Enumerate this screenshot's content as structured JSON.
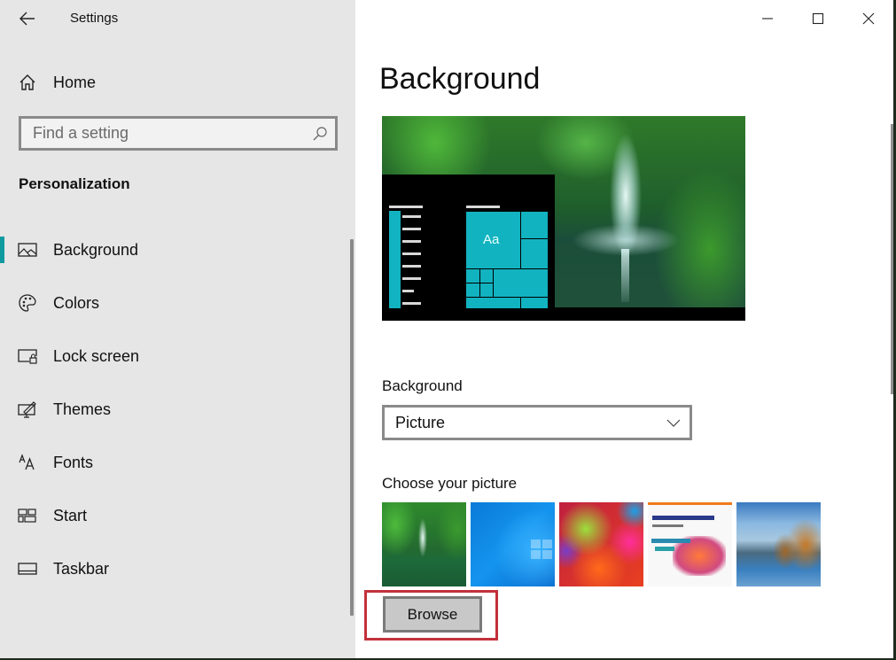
{
  "window": {
    "app_title": "Settings",
    "controls": {
      "minimize": "minimize-icon",
      "maximize": "maximize-icon",
      "close": "close-icon"
    }
  },
  "sidebar": {
    "back_icon": "back-arrow-icon",
    "home": {
      "label": "Home",
      "icon": "home-icon"
    },
    "search": {
      "placeholder": "Find a setting",
      "value": "",
      "icon": "search-icon"
    },
    "section_title": "Personalization",
    "items": [
      {
        "label": "Background",
        "icon": "picture-icon",
        "active": true
      },
      {
        "label": "Colors",
        "icon": "palette-icon",
        "active": false
      },
      {
        "label": "Lock screen",
        "icon": "lock-screen-icon",
        "active": false
      },
      {
        "label": "Themes",
        "icon": "themes-icon",
        "active": false
      },
      {
        "label": "Fonts",
        "icon": "fonts-icon",
        "active": false
      },
      {
        "label": "Start",
        "icon": "start-icon",
        "active": false
      },
      {
        "label": "Taskbar",
        "icon": "taskbar-icon",
        "active": false
      }
    ],
    "accent_color": "#0f9aa0"
  },
  "main": {
    "page_title": "Background",
    "preview": {
      "tile_text": "Aa",
      "tile_color": "#12b3c0"
    },
    "background_field": {
      "label": "Background",
      "selected": "Picture"
    },
    "choose_picture": {
      "label": "Choose your picture",
      "thumbnails": [
        {
          "name": "waterfall"
        },
        {
          "name": "windows-blue"
        },
        {
          "name": "umbrellas"
        },
        {
          "name": "honor-magicbook-ad"
        },
        {
          "name": "beach-rocks"
        }
      ]
    },
    "browse_label": "Browse",
    "highlight_color": "#c3313b"
  }
}
